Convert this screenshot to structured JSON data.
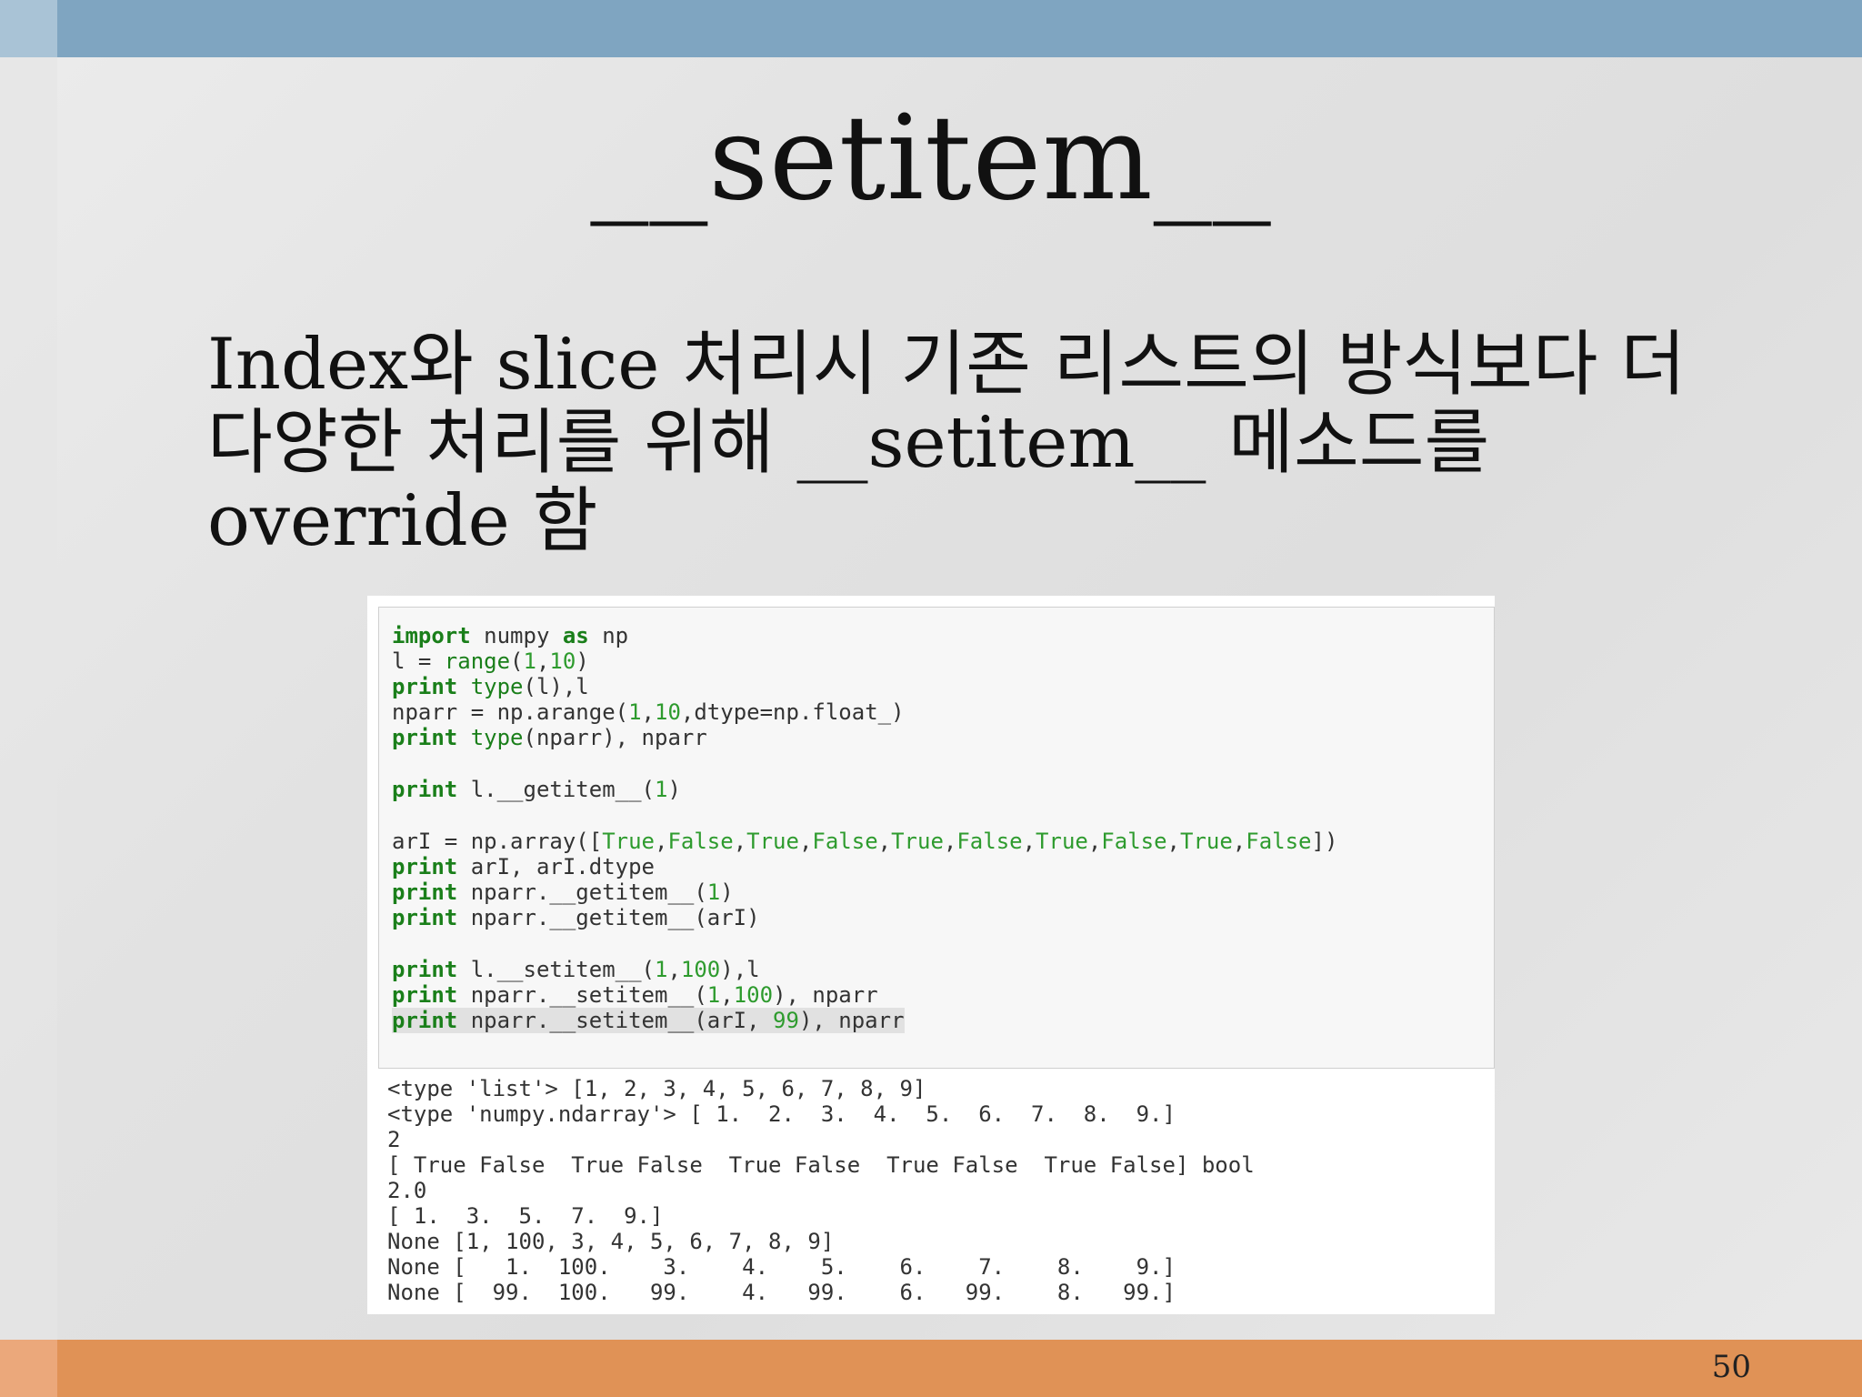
{
  "slide": {
    "title": "__setitem__",
    "body_lines": [
      "Index와 slice 처리시 기존 리스트의 방식보다 더",
      "다양한 처리를 위해 __setitem__ 메소드를",
      "override 함"
    ],
    "page_number": "50"
  },
  "colors": {
    "top_bar": "#7fa5c1",
    "bottom_bar": "#e09256",
    "keyword": "#1a7f1a"
  },
  "code": {
    "l1_kw1": "import",
    "l1_rest": " numpy ",
    "l1_kw2": "as",
    "l1_tail": " np",
    "l2_a": "l = ",
    "l2_fn": "range",
    "l2_b": "(",
    "l2_n1": "1",
    "l2_c": ",",
    "l2_n2": "10",
    "l2_d": ")",
    "l3_kw": "print",
    "l3_sp": " ",
    "l3_fn": "type",
    "l3_rest": "(l),l",
    "l4_a": "nparr = np.arange(",
    "l4_n1": "1",
    "l4_b": ",",
    "l4_n2": "10",
    "l4_c": ",dtype=np.float_)",
    "l5_kw": "print",
    "l5_sp": " ",
    "l5_fn": "type",
    "l5_rest": "(nparr), nparr",
    "l6_kw": "print",
    "l6_a": " l.__getitem__(",
    "l6_n": "1",
    "l6_b": ")",
    "l7_a": "arI = np.array([",
    "l7_t1": "True",
    "c1": ",",
    "l7_f1": "False",
    "c2": ",",
    "l7_t2": "True",
    "c3": ",",
    "l7_f2": "False",
    "c4": ",",
    "l7_t3": "True",
    "c5": ",",
    "l7_f3": "False",
    "c6": ",",
    "l7_t4": "True",
    "c7": ",",
    "l7_f4": "False",
    "c8": ",",
    "l7_t5": "True",
    "c9": ",",
    "l7_f5": "False",
    "l7_b": "])",
    "l8_kw": "print",
    "l8_rest": " arI, arI.dtype",
    "l9_kw": "print",
    "l9_a": " nparr.__getitem__(",
    "l9_n": "1",
    "l9_b": ")",
    "l10_kw": "print",
    "l10_rest": " nparr.__getitem__(arI)",
    "l11_kw": "print",
    "l11_a": " l.__setitem__(",
    "l11_n1": "1",
    "l11_c": ",",
    "l11_n2": "100",
    "l11_b": "),l",
    "l12_kw": "print",
    "l12_a": " nparr.__setitem__(",
    "l12_n1": "1",
    "l12_c": ",",
    "l12_n2": "100",
    "l12_b": "), nparr",
    "l13_kw": "print",
    "l13_a": " nparr.__setitem__(arI, ",
    "l13_n": "99",
    "l13_b": "), nparr"
  },
  "output": [
    "<type 'list'> [1, 2, 3, 4, 5, 6, 7, 8, 9]",
    "<type 'numpy.ndarray'> [ 1.  2.  3.  4.  5.  6.  7.  8.  9.]",
    "2",
    "[ True False  True False  True False  True False  True False] bool",
    "2.0",
    "[ 1.  3.  5.  7.  9.]",
    "None [1, 100, 3, 4, 5, 6, 7, 8, 9]",
    "None [   1.  100.    3.    4.    5.    6.    7.    8.    9.]",
    "None [  99.  100.   99.    4.   99.    6.   99.    8.   99.]"
  ]
}
